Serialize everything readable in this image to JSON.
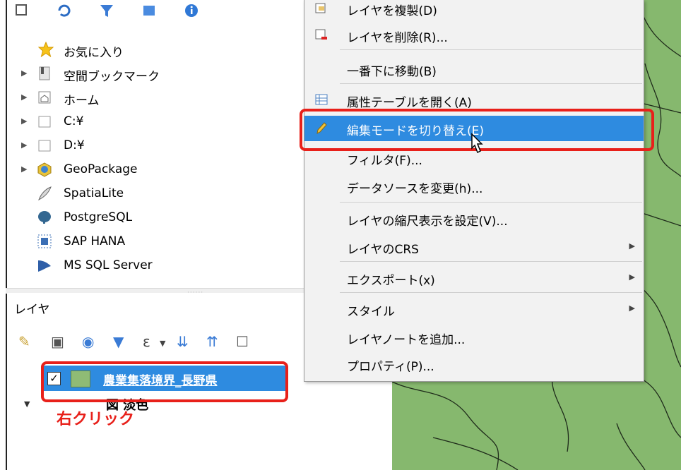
{
  "browser": {
    "items": [
      {
        "label": "お気に入り",
        "icon": "star-icon",
        "expandable": false
      },
      {
        "label": "空間ブックマーク",
        "icon": "bookmark-icon",
        "expandable": true
      },
      {
        "label": "ホーム",
        "icon": "home-folder-icon",
        "expandable": true
      },
      {
        "label": "C:¥",
        "icon": "folder-icon",
        "expandable": true
      },
      {
        "label": "D:¥",
        "icon": "folder-icon",
        "expandable": true
      },
      {
        "label": "GeoPackage",
        "icon": "geopackage-icon",
        "expandable": true
      },
      {
        "label": "SpatiaLite",
        "icon": "feather-icon",
        "expandable": false
      },
      {
        "label": "PostgreSQL",
        "icon": "elephant-icon",
        "expandable": false
      },
      {
        "label": "SAP HANA",
        "icon": "grid-icon",
        "expandable": false
      },
      {
        "label": "MS SQL Server",
        "icon": "mssql-icon",
        "expandable": false
      }
    ]
  },
  "layers": {
    "title": "レイヤ",
    "selected_layer": "農業集落境界_長野県",
    "selected_layer_checked": true,
    "second_layer": "図 淡色",
    "annotation": "右クリック"
  },
  "context_menu": {
    "items": [
      {
        "label": "レイヤを複製(D)",
        "icon": "duplicate-icon",
        "submenu": false
      },
      {
        "label": "レイヤを削除(R)...",
        "icon": "remove-layer-icon",
        "submenu": false
      },
      {
        "label": "一番下に移動(B)",
        "icon": "",
        "submenu": false
      },
      {
        "label": "属性テーブルを開く(A)",
        "icon": "table-icon",
        "submenu": false
      },
      {
        "label": "編集モードを切り替え(E)",
        "icon": "pencil-icon",
        "submenu": false,
        "active": true
      },
      {
        "label": "フィルタ(F)...",
        "icon": "",
        "submenu": false
      },
      {
        "label": "データソースを変更(h)...",
        "icon": "",
        "submenu": false
      },
      {
        "label": "レイヤの縮尺表示を設定(V)...",
        "icon": "",
        "submenu": false
      },
      {
        "label": "レイヤのCRS",
        "icon": "",
        "submenu": true
      },
      {
        "label": "エクスポート(x)",
        "icon": "",
        "submenu": true
      },
      {
        "label": "スタイル",
        "icon": "",
        "submenu": true
      },
      {
        "label": "レイヤノートを追加...",
        "icon": "",
        "submenu": false
      },
      {
        "label": "プロパティ(P)...",
        "icon": "",
        "submenu": false
      }
    ]
  },
  "colors": {
    "highlight": "#e8201a",
    "selection": "#2e8be0",
    "map_fill": "#86b86e"
  }
}
